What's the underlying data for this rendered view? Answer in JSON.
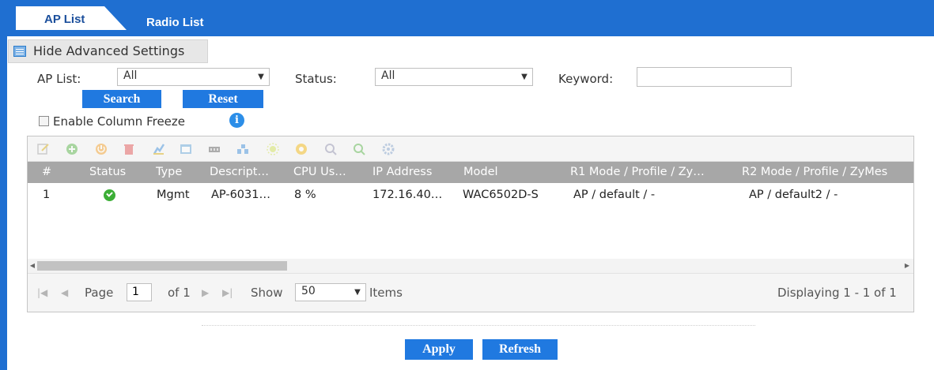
{
  "tabs": [
    {
      "label": "AP List",
      "active": true
    },
    {
      "label": "Radio List",
      "active": false
    }
  ],
  "advanced_toggle": {
    "label": "Hide Advanced Settings"
  },
  "filters": {
    "ap_list_label": "AP List:",
    "ap_list_value": "All",
    "status_label": "Status:",
    "status_value": "All",
    "keyword_label": "Keyword:",
    "keyword_value": "",
    "search_label": "Search",
    "reset_label": "Reset",
    "column_freeze_label": "Enable Column Freeze"
  },
  "toolbar_icons": [
    "edit-icon",
    "add-icon",
    "power-icon",
    "delete-icon",
    "user-icon",
    "window-icon",
    "memory-icon",
    "network-icon",
    "sun-icon",
    "circle-icon",
    "search-user-icon",
    "user-check-icon",
    "gear-icon"
  ],
  "table": {
    "headers": [
      "#",
      "Status",
      "Type",
      "Descript…",
      "CPU Us…",
      "IP Address",
      "Model",
      "R1 Mode / Profile / Zy…",
      "R2 Mode / Profile / ZyMes"
    ],
    "rows": [
      {
        "num": "1",
        "status": "ok",
        "type": "Mgmt",
        "description": "AP-6031…",
        "cpu": "8 %",
        "ip": "172.16.40…",
        "model": "WAC6502D-S",
        "r1": "AP / default / -",
        "r2": "AP / default2 / -"
      }
    ]
  },
  "pager": {
    "page_label": "Page",
    "page_value": "1",
    "of_label": "of 1",
    "show_label": "Show",
    "show_value": "50",
    "items_label": "Items",
    "display_label": "Displaying 1 - 1 of 1"
  },
  "actions": {
    "apply_label": "Apply",
    "refresh_label": "Refresh"
  },
  "colors": {
    "accent": "#1f6fd1",
    "button": "#2079e0",
    "header": "#a7a7a7"
  }
}
